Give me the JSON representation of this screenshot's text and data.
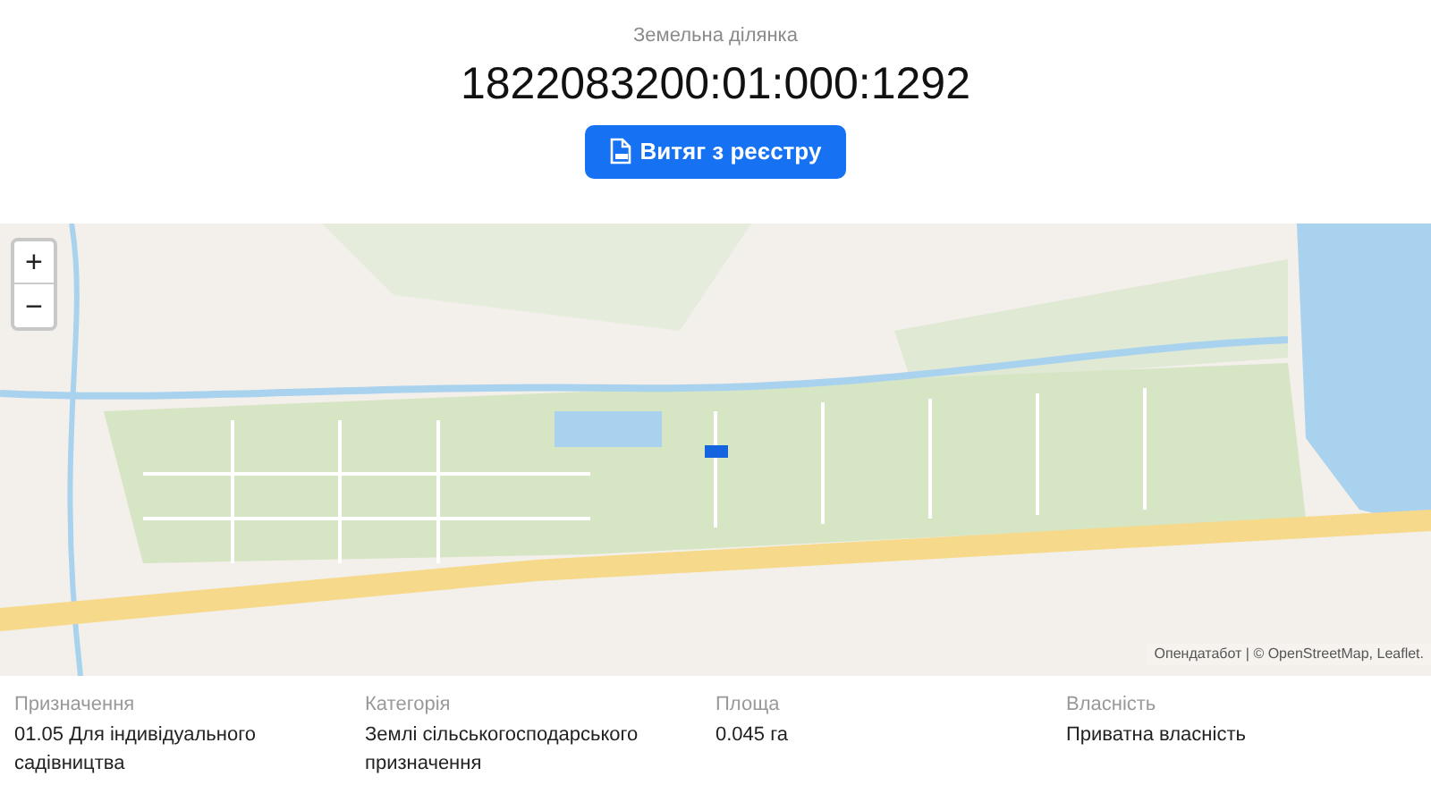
{
  "header": {
    "subtitle": "Земельна ділянка",
    "title": "1822083200:01:000:1292",
    "button": "Витяг з реєстру"
  },
  "map": {
    "kind": "picture",
    "zoom_in": "+",
    "zoom_out": "−",
    "attribution": "Опендатабот | © OpenStreetMap, Leaflet."
  },
  "details": [
    {
      "label": "Призначення",
      "value": "01.05 Для індивідуального садівництва"
    },
    {
      "label": "Категорія",
      "value": "Землі сільськогосподарського призначення"
    },
    {
      "label": "Площа",
      "value": "0.045 га"
    },
    {
      "label": "Власність",
      "value": "Приватна власність"
    }
  ]
}
